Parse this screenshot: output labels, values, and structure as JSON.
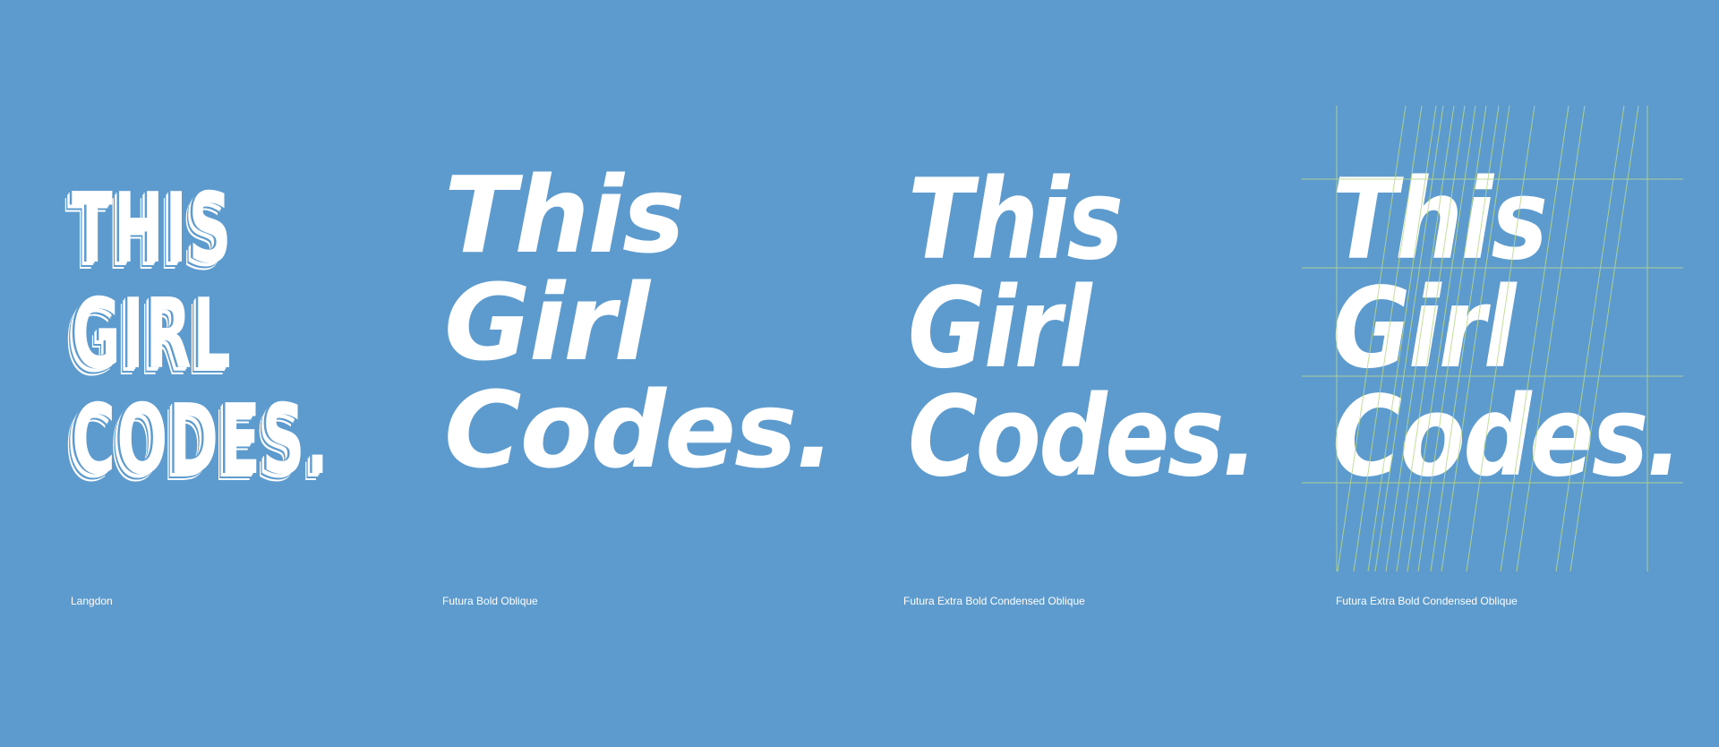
{
  "specimens": [
    {
      "lines": [
        "THIS",
        "GIRL",
        "CODES."
      ],
      "caption": "Langdon"
    },
    {
      "lines": [
        "This",
        "Girl",
        "Codes."
      ],
      "caption": "Futura Bold Oblique"
    },
    {
      "lines": [
        "This",
        "Girl",
        "Codes."
      ],
      "caption": "Futura Extra Bold Condensed Oblique"
    },
    {
      "lines": [
        "This",
        "Girl",
        "Codes."
      ],
      "caption": "Futura Extra Bold Condensed Oblique",
      "grid_color": "#b9d98a"
    }
  ],
  "colors": {
    "background": "#5d9bcf",
    "text": "#ffffff"
  }
}
